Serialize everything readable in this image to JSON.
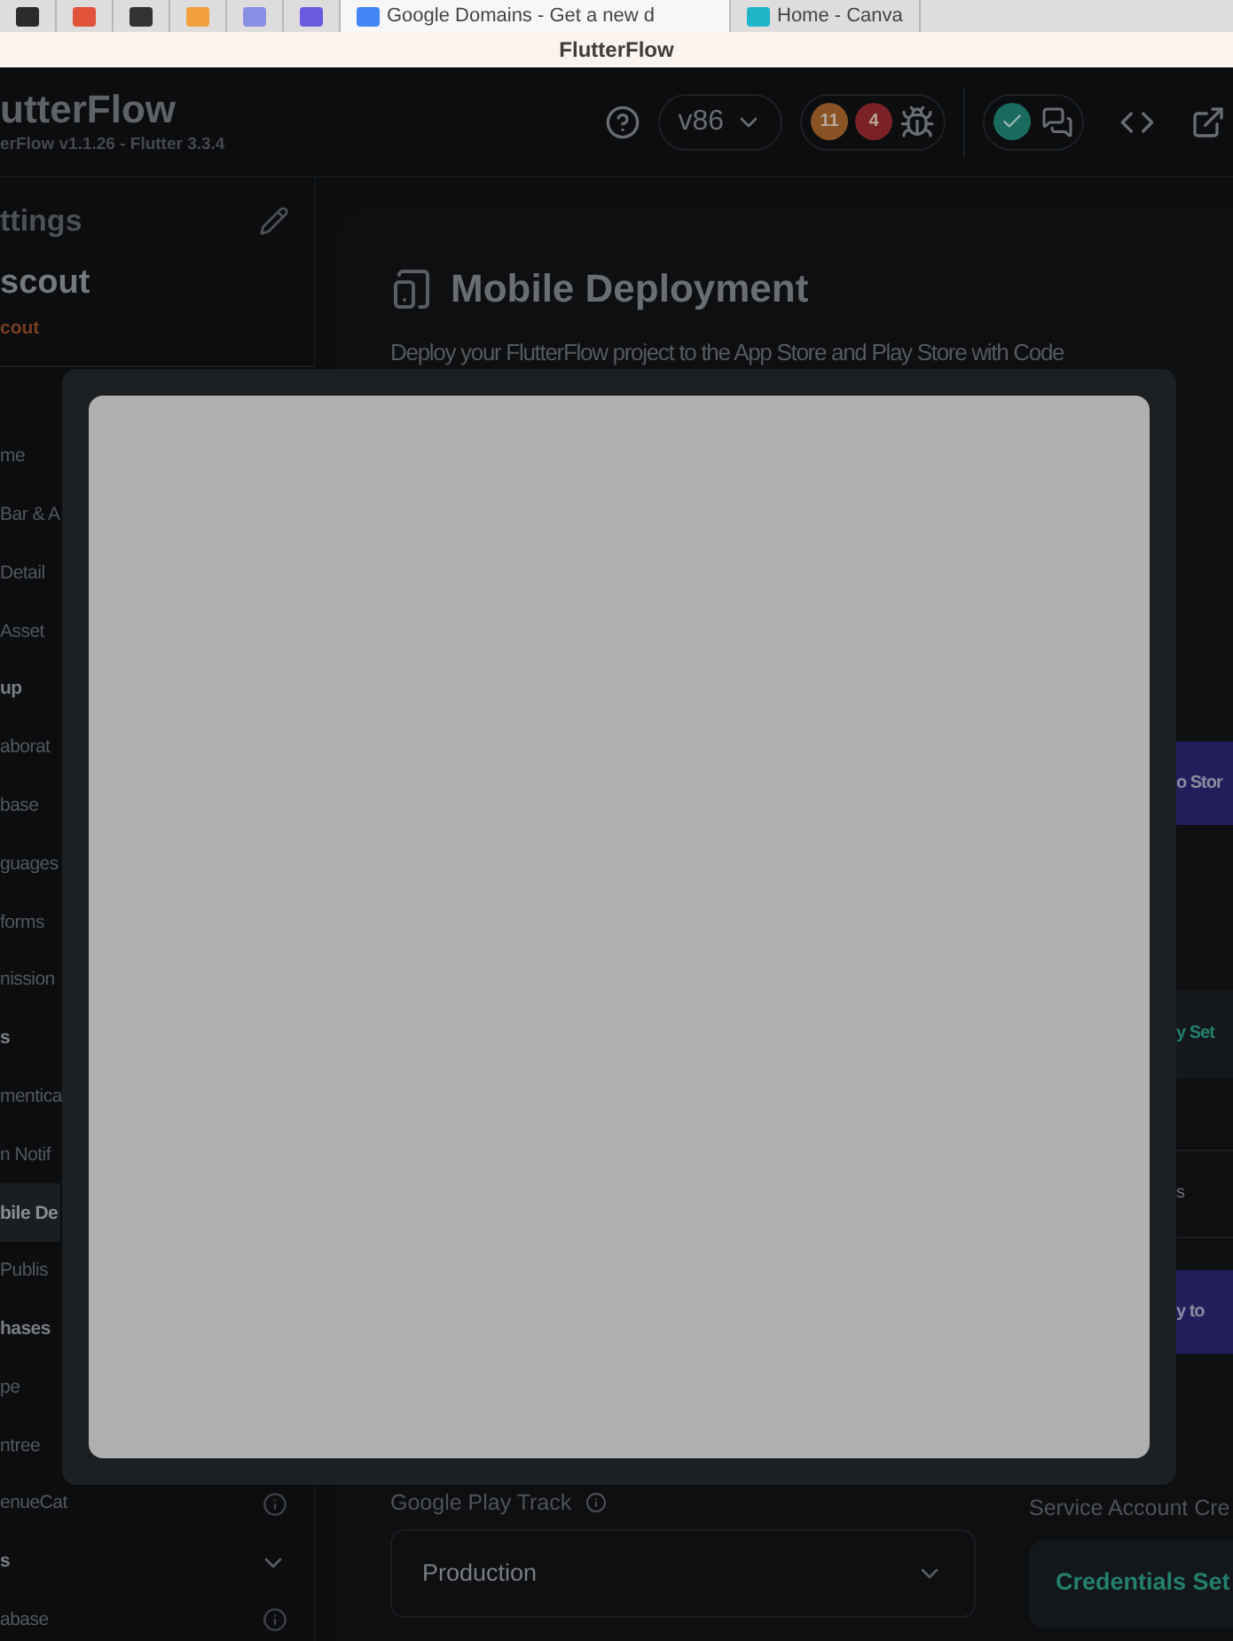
{
  "browser_tabs": [
    {
      "selected": false,
      "color": "#2b2b2b"
    },
    {
      "selected": false,
      "color": "#e0533a"
    },
    {
      "selected": false,
      "color": "#333333"
    },
    {
      "selected": false,
      "color": "#f2a03d"
    },
    {
      "selected": false,
      "color": "#8a8fe6"
    },
    {
      "selected": false,
      "color": "#6a5ae0"
    },
    {
      "label": "Google Domains - Get a new d",
      "selected": true,
      "color": "#4285f4"
    },
    {
      "label": "Home - Canva",
      "selected": false,
      "color": "#1fb5c9"
    }
  ],
  "window": {
    "title": "FlutterFlow"
  },
  "header": {
    "logo": "utterFlow",
    "version": "erFlow v1.1.26 - Flutter 3.3.4",
    "version_select": "v86",
    "badges": [
      {
        "count": "11",
        "color": "#8a5325"
      },
      {
        "count": "4",
        "color": "#7b2226"
      }
    ]
  },
  "sidebar": {
    "title": "ttings",
    "project": "scout",
    "project_id": "cout",
    "items": [
      {
        "label": "me",
        "kind": "item",
        "selected": false
      },
      {
        "label": "Bar & A",
        "kind": "item",
        "selected": false
      },
      {
        "label": "Detail",
        "kind": "item",
        "selected": false
      },
      {
        "label": "Asset",
        "kind": "item",
        "selected": false
      },
      {
        "label": "up",
        "kind": "section",
        "selected": false
      },
      {
        "label": "aborat",
        "kind": "item",
        "selected": false
      },
      {
        "label": "base",
        "kind": "item",
        "selected": false
      },
      {
        "label": "guages",
        "kind": "item",
        "selected": false
      },
      {
        "label": "forms",
        "kind": "item",
        "selected": false
      },
      {
        "label": "nission",
        "kind": "item",
        "selected": false
      },
      {
        "label": "s",
        "kind": "section",
        "selected": false
      },
      {
        "label": "mentica",
        "kind": "item",
        "selected": false
      },
      {
        "label": "n Notif",
        "kind": "item",
        "selected": false
      },
      {
        "label": "bile De",
        "kind": "item",
        "selected": true
      },
      {
        "label": "Publis",
        "kind": "item",
        "selected": false
      },
      {
        "label": "hases",
        "kind": "section",
        "selected": false
      },
      {
        "label": "pe",
        "kind": "item",
        "selected": false
      },
      {
        "label": "ntree",
        "kind": "item",
        "selected": false
      },
      {
        "label": "enueCat",
        "kind": "info_item",
        "selected": false
      },
      {
        "label": "s",
        "kind": "collapsible_section",
        "selected": false
      },
      {
        "label": "abase",
        "kind": "info_item",
        "selected": false
      }
    ]
  },
  "page": {
    "title": "Mobile Deployment",
    "description": "Deploy your FlutterFlow project to the App Store and Play Store with Code",
    "right_edge": [
      {
        "kind": "primary",
        "label": "o Stor"
      },
      {
        "kind": "status",
        "label": "y Set"
      },
      {
        "kind": "text",
        "label": "s"
      },
      {
        "kind": "primary",
        "label": "y to"
      }
    ],
    "google_play_track": {
      "label": "Google Play Track",
      "value": "Production"
    },
    "service_account": {
      "label": "Service Account Cre",
      "status": "Credentials Set"
    }
  }
}
